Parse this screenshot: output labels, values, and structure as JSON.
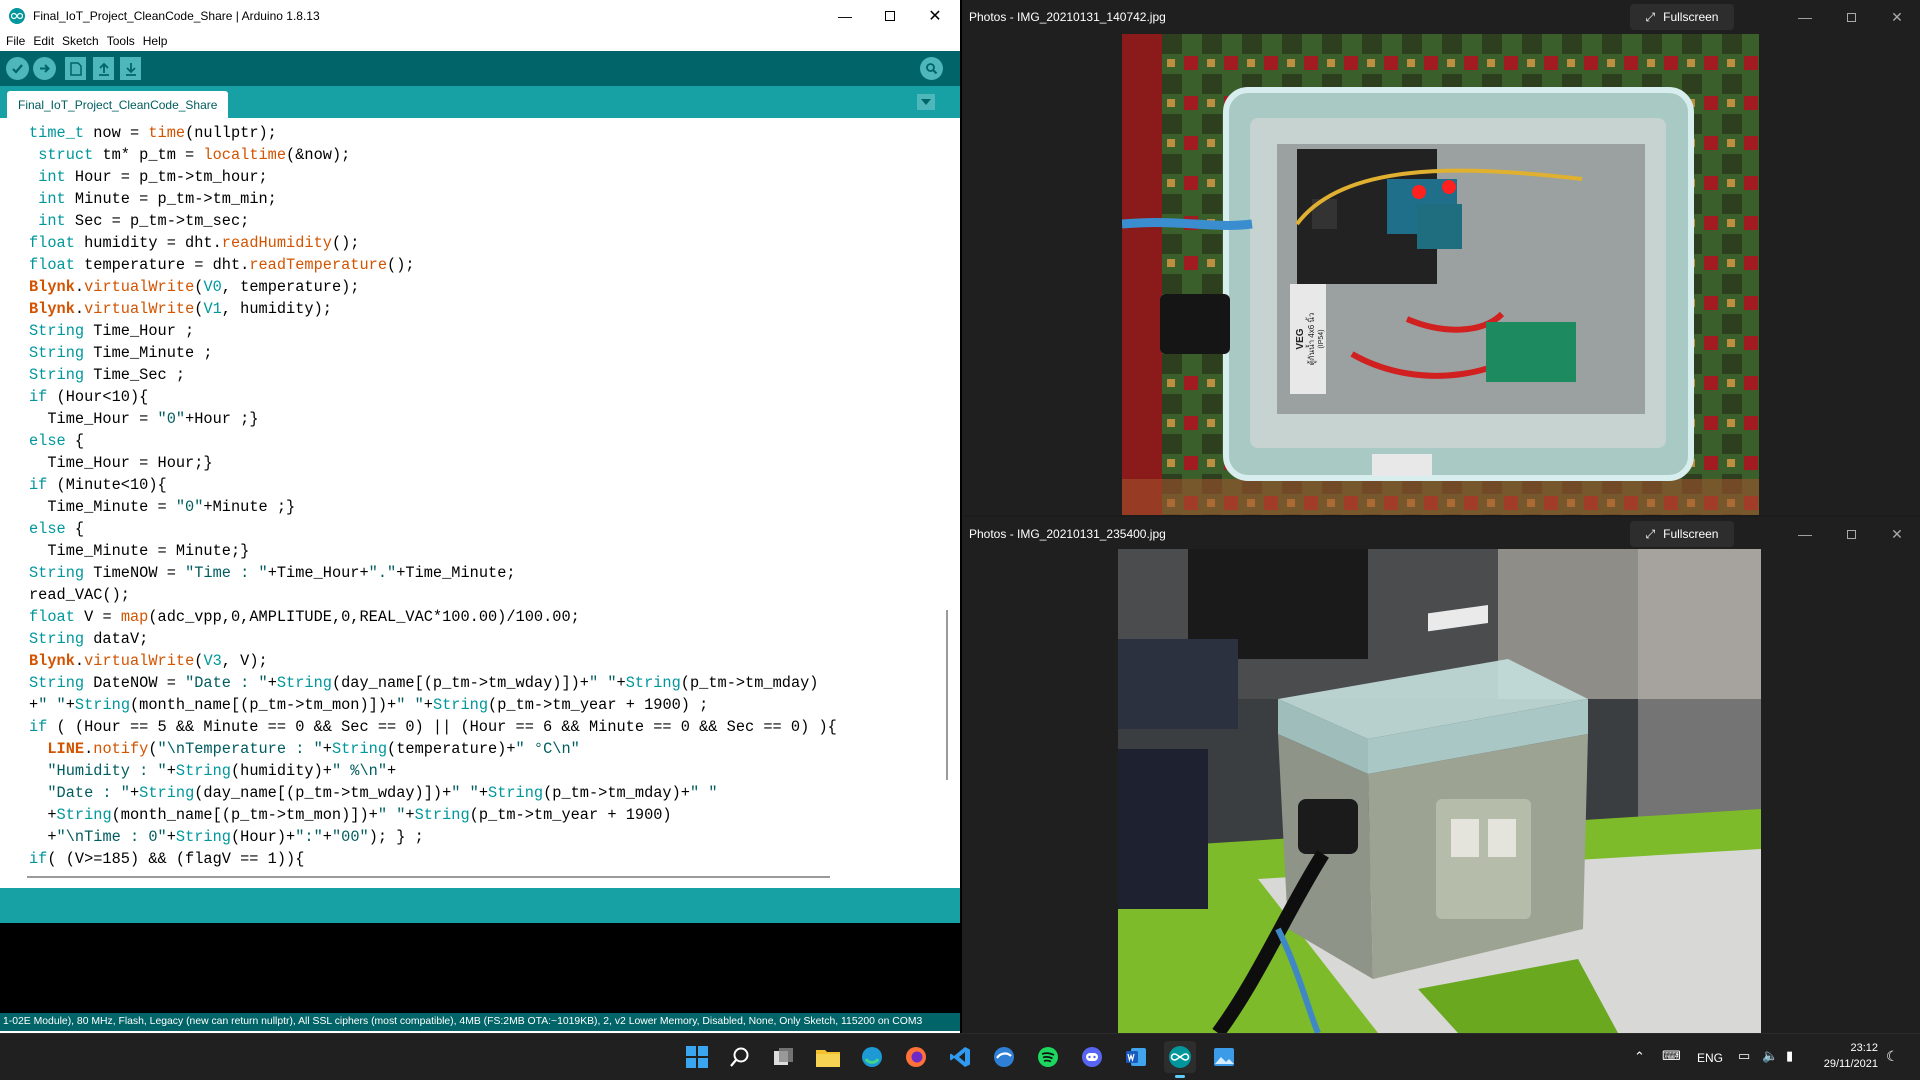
{
  "arduino": {
    "title": "Final_IoT_Project_CleanCode_Share | Arduino 1.8.13",
    "menu": [
      "File",
      "Edit",
      "Sketch",
      "Tools",
      "Help"
    ],
    "tab_label": "Final_IoT_Project_CleanCode_Share",
    "toolbar_icons": [
      "verify-icon",
      "upload-icon",
      "new-icon",
      "open-icon",
      "save-icon",
      "serial-monitor-icon"
    ],
    "code_lines": [
      "time_t now = time(nullptr);",
      " struct tm* p_tm = localtime(&now);",
      " int Hour = p_tm->tm_hour;",
      " int Minute = p_tm->tm_min;",
      " int Sec = p_tm->tm_sec;",
      "float humidity = dht.readHumidity();",
      "float temperature = dht.readTemperature();",
      "Blynk.virtualWrite(V0, temperature);",
      "Blynk.virtualWrite(V1, humidity);",
      "String Time_Hour ;",
      "String Time_Minute ;",
      "String Time_Sec ;",
      "if (Hour<10){",
      "  Time_Hour = \"0\"+Hour ;}",
      "else {",
      "  Time_Hour = Hour;}",
      "if (Minute<10){",
      "  Time_Minute = \"0\"+Minute ;}",
      "else {",
      "  Time_Minute = Minute;}",
      "String TimeNOW = \"Time : \"+Time_Hour+\".\"+Time_Minute;",
      "read_VAC();",
      "float V = map(adc_vpp,0,AMPLITUDE,0,REAL_VAC*100.00)/100.00;",
      "String dataV;",
      "Blynk.virtualWrite(V3, V);",
      "String DateNOW = \"Date : \"+String(day_name[(p_tm->tm_wday)])+\" \"+String(p_tm->tm_mday)",
      "+\" \"+String(month_name[(p_tm->tm_mon)])+\" \"+String(p_tm->tm_year + 1900) ;",
      "if ( (Hour == 5 && Minute == 0 && Sec == 0) || (Hour == 6 && Minute == 0 && Sec == 0) ){",
      "  LINE.notify(\"\\nTemperature : \"+String(temperature)+\" °C\\n\"",
      "  \"Humidity : \"+String(humidity)+\" %\\n\"+",
      "  \"Date : \"+String(day_name[(p_tm->tm_wday)])+\" \"+String(p_tm->tm_mday)+\" \"",
      "  +String(month_name[(p_tm->tm_mon)])+\" \"+String(p_tm->tm_year + 1900)",
      "  +\"\\nTime : 0\"+String(Hour)+\":\"+\"00\"); } ;",
      "if( (V>=185) && (flagV == 1)){"
    ],
    "status_line": "1-02E Module), 80 MHz, Flash, Legacy (new can return nullptr), All SSL ciphers (most compatible), 4MB (FS:2MB OTA:~1019KB), 2, v2 Lower Memory, Disabled, None, Only Sketch, 115200 on COM3"
  },
  "photos_top": {
    "title": "Photos - IMG_20210131_140742.jpg",
    "fullscreen_label": "Fullscreen",
    "box_label_line1": "VEG",
    "box_label_line2": "ตู้กันน้ำ 4x6 นิ้ว",
    "box_label_line3": "(IP54)"
  },
  "photos_bottom": {
    "title": "Photos - IMG_20210131_235400.jpg",
    "fullscreen_label": "Fullscreen"
  },
  "taskbar": {
    "apps": [
      "start-icon",
      "search-icon",
      "task-view-icon",
      "file-explorer-icon",
      "edge-icon",
      "firefox-icon",
      "vscode-icon",
      "app-globe-icon",
      "spotify-icon",
      "discord-icon",
      "word-icon",
      "arduino-icon",
      "photos-icon"
    ],
    "lang": "ENG",
    "time": "23:12",
    "date": "29/11/2021"
  },
  "colors": {
    "arduino_dark": "#006468",
    "arduino_teal": "#17a1a5",
    "keyword_type": "#00979c",
    "keyword_fn": "#d35400"
  }
}
